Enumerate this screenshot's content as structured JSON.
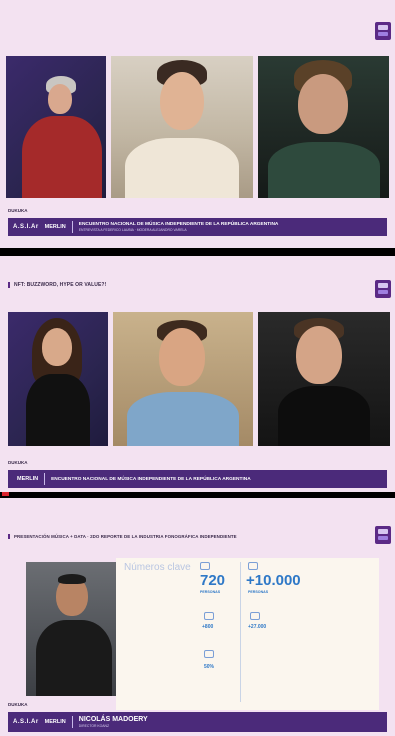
{
  "panel1": {
    "segment_title": "",
    "pre_bar": "DUKUKA",
    "brand": "A.S.I.Ar",
    "brand2": "MERLIN",
    "bar_main": "ENCUENTRO NACIONAL DE MÚSICA INDEPENDIENTE DE LA REPÚBLICA ARGENTINA",
    "bar_sub": "ENTREVISTA A FEDERICO LAUBIA · MODERA ALEJANDRO VARELA"
  },
  "panel2": {
    "segment_title": "NFT: BUZZWORD, HYPE OR VALUE?!",
    "pre_bar": "DUKUKA",
    "brand2": "MERLIN",
    "bar_main": "ENCUENTRO NACIONAL DE MÚSICA INDEPENDIENTE DE LA REPÚBLICA ARGENTINA"
  },
  "panel3": {
    "segment_title": "PRESENTACIÓN MÚSICA + DATA · 2DO REPORTE DE LA INDUSTRIA FONOGRÁFICA INDEPENDIENTE",
    "pre_bar": "DUKUKA",
    "brand": "A.S.I.Ar",
    "brand2": "MERLIN",
    "name": "NICOLÁS MADOERY",
    "role": "DIRECTOR KOANZ",
    "infobox": {
      "title": "Números clave",
      "stat1_value": "720",
      "stat1_label": "PERSONAS",
      "stat2_value": "+10.000",
      "stat2_label": "PERSONAS",
      "stat3_value": "+800",
      "stat4_value": "+27.000",
      "stat5_value": "50%"
    }
  },
  "colors": {
    "panel_bg": "#f3e2f1",
    "bar_purple": "#4b2a7a",
    "stat_blue": "#2e78c7"
  }
}
